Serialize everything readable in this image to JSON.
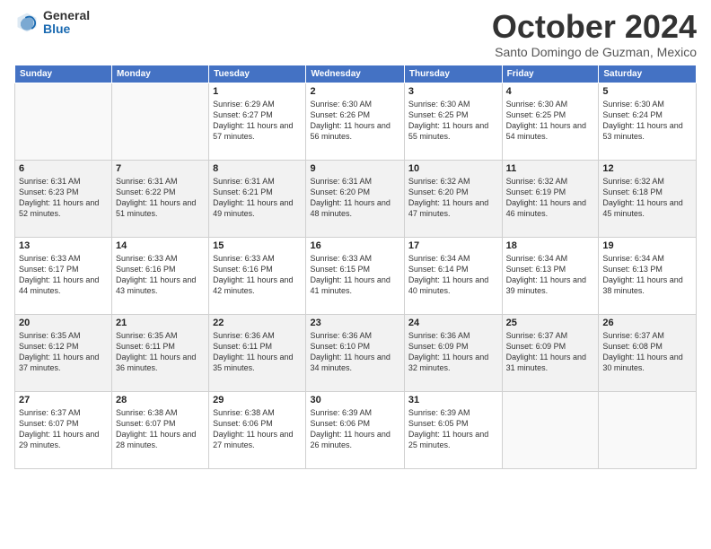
{
  "header": {
    "logo_general": "General",
    "logo_blue": "Blue",
    "month_title": "October 2024",
    "subtitle": "Santo Domingo de Guzman, Mexico"
  },
  "weekdays": [
    "Sunday",
    "Monday",
    "Tuesday",
    "Wednesday",
    "Thursday",
    "Friday",
    "Saturday"
  ],
  "weeks": [
    [
      {
        "day": "",
        "sunrise": "",
        "sunset": "",
        "daylight": ""
      },
      {
        "day": "",
        "sunrise": "",
        "sunset": "",
        "daylight": ""
      },
      {
        "day": "1",
        "sunrise": "Sunrise: 6:29 AM",
        "sunset": "Sunset: 6:27 PM",
        "daylight": "Daylight: 11 hours and 57 minutes."
      },
      {
        "day": "2",
        "sunrise": "Sunrise: 6:30 AM",
        "sunset": "Sunset: 6:26 PM",
        "daylight": "Daylight: 11 hours and 56 minutes."
      },
      {
        "day": "3",
        "sunrise": "Sunrise: 6:30 AM",
        "sunset": "Sunset: 6:25 PM",
        "daylight": "Daylight: 11 hours and 55 minutes."
      },
      {
        "day": "4",
        "sunrise": "Sunrise: 6:30 AM",
        "sunset": "Sunset: 6:25 PM",
        "daylight": "Daylight: 11 hours and 54 minutes."
      },
      {
        "day": "5",
        "sunrise": "Sunrise: 6:30 AM",
        "sunset": "Sunset: 6:24 PM",
        "daylight": "Daylight: 11 hours and 53 minutes."
      }
    ],
    [
      {
        "day": "6",
        "sunrise": "Sunrise: 6:31 AM",
        "sunset": "Sunset: 6:23 PM",
        "daylight": "Daylight: 11 hours and 52 minutes."
      },
      {
        "day": "7",
        "sunrise": "Sunrise: 6:31 AM",
        "sunset": "Sunset: 6:22 PM",
        "daylight": "Daylight: 11 hours and 51 minutes."
      },
      {
        "day": "8",
        "sunrise": "Sunrise: 6:31 AM",
        "sunset": "Sunset: 6:21 PM",
        "daylight": "Daylight: 11 hours and 49 minutes."
      },
      {
        "day": "9",
        "sunrise": "Sunrise: 6:31 AM",
        "sunset": "Sunset: 6:20 PM",
        "daylight": "Daylight: 11 hours and 48 minutes."
      },
      {
        "day": "10",
        "sunrise": "Sunrise: 6:32 AM",
        "sunset": "Sunset: 6:20 PM",
        "daylight": "Daylight: 11 hours and 47 minutes."
      },
      {
        "day": "11",
        "sunrise": "Sunrise: 6:32 AM",
        "sunset": "Sunset: 6:19 PM",
        "daylight": "Daylight: 11 hours and 46 minutes."
      },
      {
        "day": "12",
        "sunrise": "Sunrise: 6:32 AM",
        "sunset": "Sunset: 6:18 PM",
        "daylight": "Daylight: 11 hours and 45 minutes."
      }
    ],
    [
      {
        "day": "13",
        "sunrise": "Sunrise: 6:33 AM",
        "sunset": "Sunset: 6:17 PM",
        "daylight": "Daylight: 11 hours and 44 minutes."
      },
      {
        "day": "14",
        "sunrise": "Sunrise: 6:33 AM",
        "sunset": "Sunset: 6:16 PM",
        "daylight": "Daylight: 11 hours and 43 minutes."
      },
      {
        "day": "15",
        "sunrise": "Sunrise: 6:33 AM",
        "sunset": "Sunset: 6:16 PM",
        "daylight": "Daylight: 11 hours and 42 minutes."
      },
      {
        "day": "16",
        "sunrise": "Sunrise: 6:33 AM",
        "sunset": "Sunset: 6:15 PM",
        "daylight": "Daylight: 11 hours and 41 minutes."
      },
      {
        "day": "17",
        "sunrise": "Sunrise: 6:34 AM",
        "sunset": "Sunset: 6:14 PM",
        "daylight": "Daylight: 11 hours and 40 minutes."
      },
      {
        "day": "18",
        "sunrise": "Sunrise: 6:34 AM",
        "sunset": "Sunset: 6:13 PM",
        "daylight": "Daylight: 11 hours and 39 minutes."
      },
      {
        "day": "19",
        "sunrise": "Sunrise: 6:34 AM",
        "sunset": "Sunset: 6:13 PM",
        "daylight": "Daylight: 11 hours and 38 minutes."
      }
    ],
    [
      {
        "day": "20",
        "sunrise": "Sunrise: 6:35 AM",
        "sunset": "Sunset: 6:12 PM",
        "daylight": "Daylight: 11 hours and 37 minutes."
      },
      {
        "day": "21",
        "sunrise": "Sunrise: 6:35 AM",
        "sunset": "Sunset: 6:11 PM",
        "daylight": "Daylight: 11 hours and 36 minutes."
      },
      {
        "day": "22",
        "sunrise": "Sunrise: 6:36 AM",
        "sunset": "Sunset: 6:11 PM",
        "daylight": "Daylight: 11 hours and 35 minutes."
      },
      {
        "day": "23",
        "sunrise": "Sunrise: 6:36 AM",
        "sunset": "Sunset: 6:10 PM",
        "daylight": "Daylight: 11 hours and 34 minutes."
      },
      {
        "day": "24",
        "sunrise": "Sunrise: 6:36 AM",
        "sunset": "Sunset: 6:09 PM",
        "daylight": "Daylight: 11 hours and 32 minutes."
      },
      {
        "day": "25",
        "sunrise": "Sunrise: 6:37 AM",
        "sunset": "Sunset: 6:09 PM",
        "daylight": "Daylight: 11 hours and 31 minutes."
      },
      {
        "day": "26",
        "sunrise": "Sunrise: 6:37 AM",
        "sunset": "Sunset: 6:08 PM",
        "daylight": "Daylight: 11 hours and 30 minutes."
      }
    ],
    [
      {
        "day": "27",
        "sunrise": "Sunrise: 6:37 AM",
        "sunset": "Sunset: 6:07 PM",
        "daylight": "Daylight: 11 hours and 29 minutes."
      },
      {
        "day": "28",
        "sunrise": "Sunrise: 6:38 AM",
        "sunset": "Sunset: 6:07 PM",
        "daylight": "Daylight: 11 hours and 28 minutes."
      },
      {
        "day": "29",
        "sunrise": "Sunrise: 6:38 AM",
        "sunset": "Sunset: 6:06 PM",
        "daylight": "Daylight: 11 hours and 27 minutes."
      },
      {
        "day": "30",
        "sunrise": "Sunrise: 6:39 AM",
        "sunset": "Sunset: 6:06 PM",
        "daylight": "Daylight: 11 hours and 26 minutes."
      },
      {
        "day": "31",
        "sunrise": "Sunrise: 6:39 AM",
        "sunset": "Sunset: 6:05 PM",
        "daylight": "Daylight: 11 hours and 25 minutes."
      },
      {
        "day": "",
        "sunrise": "",
        "sunset": "",
        "daylight": ""
      },
      {
        "day": "",
        "sunrise": "",
        "sunset": "",
        "daylight": ""
      }
    ]
  ]
}
